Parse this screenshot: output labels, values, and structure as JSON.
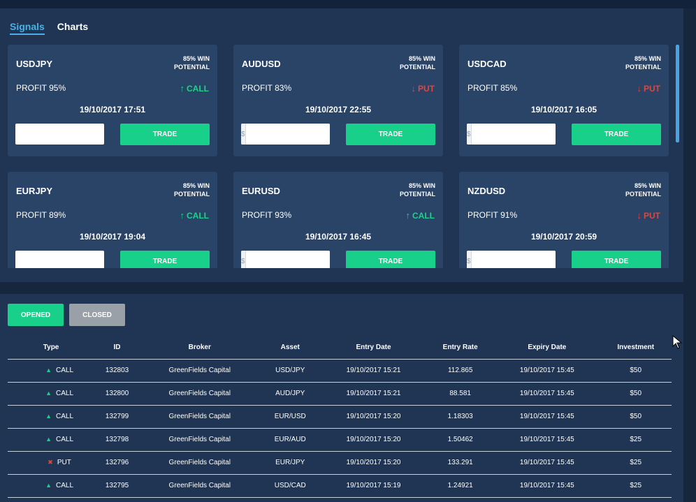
{
  "tabs": [
    {
      "label": "Signals",
      "active": true
    },
    {
      "label": "Charts",
      "active": false
    }
  ],
  "cards": [
    {
      "pair": "USDJPY",
      "win_line1": "85% WIN",
      "win_line2": "POTENTIAL",
      "profit": "PROFIT 95%",
      "direction": "CALL",
      "date": "19/10/2017 17:51",
      "currency": "",
      "trade_label": "TRADE"
    },
    {
      "pair": "AUDUSD",
      "win_line1": "85% WIN",
      "win_line2": "POTENTIAL",
      "profit": "PROFIT 83%",
      "direction": "PUT",
      "date": "19/10/2017 22:55",
      "currency": "$",
      "trade_label": "TRADE"
    },
    {
      "pair": "USDCAD",
      "win_line1": "85% WIN",
      "win_line2": "POTENTIAL",
      "profit": "PROFIT 85%",
      "direction": "PUT",
      "date": "19/10/2017 16:05",
      "currency": "$",
      "trade_label": "TRADE"
    },
    {
      "pair": "EURJPY",
      "win_line1": "85% WIN",
      "win_line2": "POTENTIAL",
      "profit": "PROFIT 89%",
      "direction": "CALL",
      "date": "19/10/2017 19:04",
      "currency": "",
      "trade_label": "TRADE"
    },
    {
      "pair": "EURUSD",
      "win_line1": "85% WIN",
      "win_line2": "POTENTIAL",
      "profit": "PROFIT 93%",
      "direction": "CALL",
      "date": "19/10/2017 16:45",
      "currency": "$",
      "trade_label": "TRADE"
    },
    {
      "pair": "NZDUSD",
      "win_line1": "85% WIN",
      "win_line2": "POTENTIAL",
      "profit": "PROFIT 91%",
      "direction": "PUT",
      "date": "19/10/2017 20:59",
      "currency": "$",
      "trade_label": "TRADE"
    }
  ],
  "orders": {
    "opened_label": "OPENED",
    "closed_label": "CLOSED",
    "columns": [
      "Type",
      "ID",
      "Broker",
      "Asset",
      "Entry Date",
      "Entry Rate",
      "Expiry Date",
      "Investment"
    ],
    "rows": [
      {
        "type": "CALL",
        "id": "132803",
        "broker": "GreenFields Capital",
        "asset": "USD/JPY",
        "entry_date": "19/10/2017 15:21",
        "entry_rate": "112.865",
        "expiry_date": "19/10/2017 15:45",
        "investment": "$50"
      },
      {
        "type": "CALL",
        "id": "132800",
        "broker": "GreenFields Capital",
        "asset": "AUD/JPY",
        "entry_date": "19/10/2017 15:21",
        "entry_rate": "88.581",
        "expiry_date": "19/10/2017 15:45",
        "investment": "$50"
      },
      {
        "type": "CALL",
        "id": "132799",
        "broker": "GreenFields Capital",
        "asset": "EUR/USD",
        "entry_date": "19/10/2017 15:20",
        "entry_rate": "1.18303",
        "expiry_date": "19/10/2017 15:45",
        "investment": "$50"
      },
      {
        "type": "CALL",
        "id": "132798",
        "broker": "GreenFields Capital",
        "asset": "EUR/AUD",
        "entry_date": "19/10/2017 15:20",
        "entry_rate": "1.50462",
        "expiry_date": "19/10/2017 15:45",
        "investment": "$25"
      },
      {
        "type": "PUT",
        "id": "132796",
        "broker": "GreenFields Capital",
        "asset": "EUR/JPY",
        "entry_date": "19/10/2017 15:20",
        "entry_rate": "133.291",
        "expiry_date": "19/10/2017 15:45",
        "investment": "$25"
      },
      {
        "type": "CALL",
        "id": "132795",
        "broker": "GreenFields Capital",
        "asset": "USD/CAD",
        "entry_date": "19/10/2017 15:19",
        "entry_rate": "1.24921",
        "expiry_date": "19/10/2017 15:45",
        "investment": "$25"
      }
    ]
  },
  "icons": {
    "call": "arrow-up-icon",
    "put": "arrow-down-icon",
    "help": "question-icon",
    "cursor": "mouse-cursor-icon"
  },
  "colors": {
    "accent_green": "#19d08a",
    "put_red": "#e2453a",
    "tab_active": "#4ab0e6"
  }
}
